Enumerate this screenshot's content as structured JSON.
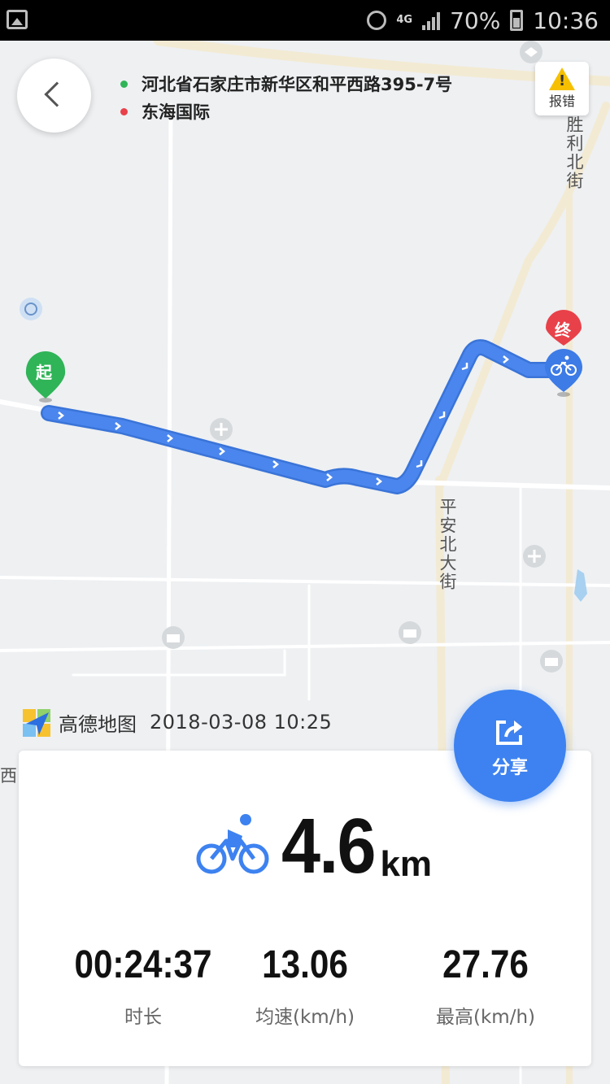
{
  "status_bar": {
    "network": "4G",
    "battery": "70%",
    "time": "10:36"
  },
  "route": {
    "start_address": "河北省石家庄市新华区和平西路395-7号",
    "end_address": "东海国际",
    "start_color": "#2fb457",
    "end_color": "#e8414a",
    "route_color": "#4a86ee"
  },
  "map": {
    "report_label": "报错",
    "street_shengli": "胜利北街",
    "street_pingan": "平安北大街",
    "edge_label": "西",
    "start_marker": "起",
    "end_marker": "终",
    "brand_name": "高德地图",
    "timestamp": "2018-03-08  10:25"
  },
  "summary": {
    "distance_value": "4.6",
    "distance_unit": "km",
    "stats": [
      {
        "value": "00:24:37",
        "label": "时长"
      },
      {
        "value": "13.06",
        "label": "均速(km/h)"
      },
      {
        "value": "27.76",
        "label": "最高(km/h)"
      }
    ]
  },
  "share": {
    "label": "分享",
    "color": "#3d82f0"
  },
  "icons": [
    "back-chevron-icon",
    "warning-icon",
    "bicycle-icon",
    "share-icon",
    "gaode-logo-icon"
  ]
}
